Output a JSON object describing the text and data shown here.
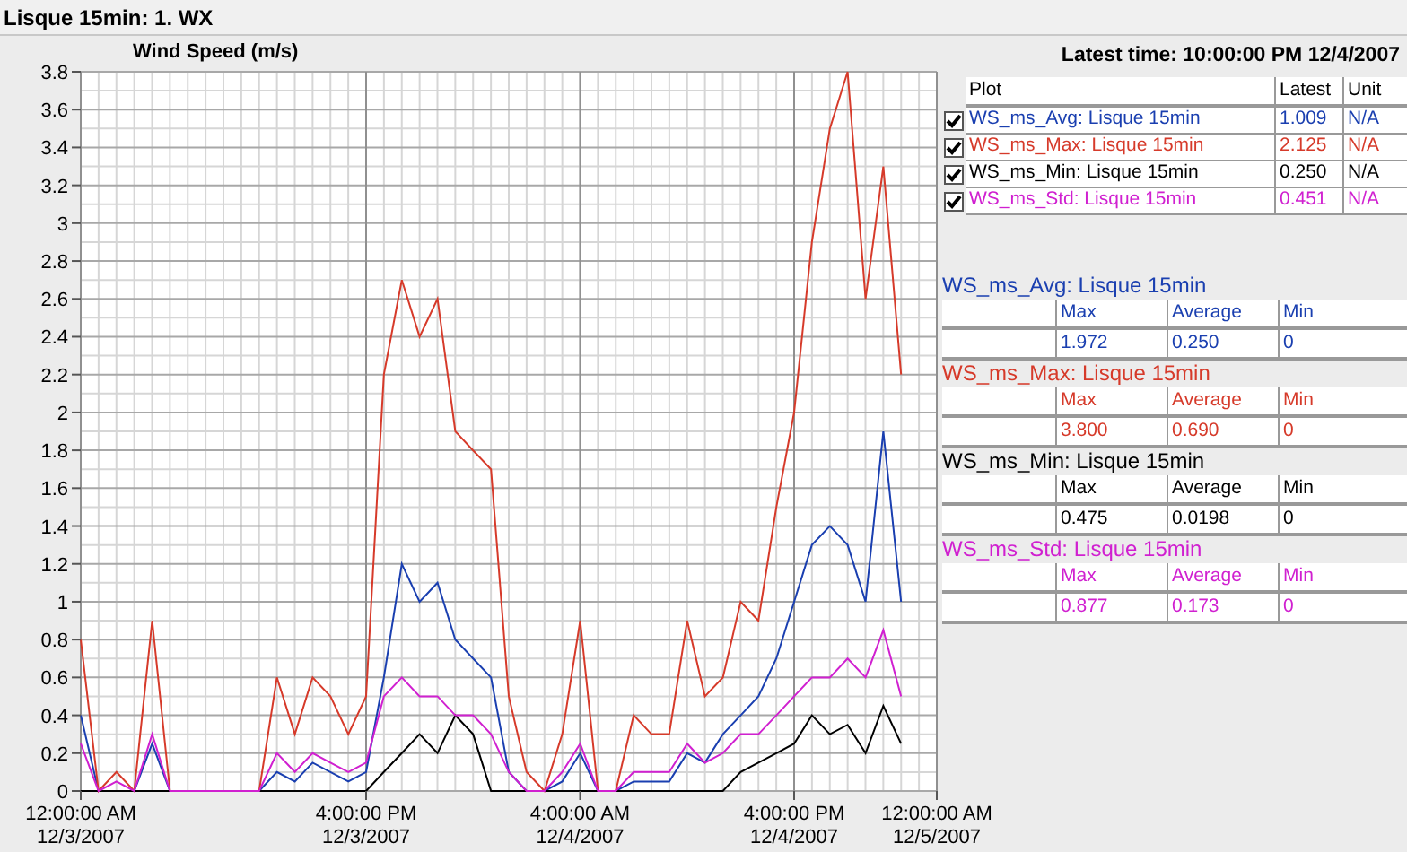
{
  "window": {
    "title": "Lisque 15min: 1. WX"
  },
  "chart": {
    "chart_data": {
      "type": "line",
      "grid": true,
      "title": "Wind Speed (m/s)",
      "categories": [
        "12:00:00 AM\n12/3/2007",
        null,
        null,
        null,
        null,
        null,
        null,
        null,
        null,
        null,
        null,
        null,
        null,
        null,
        null,
        null,
        "4:00:00 PM\n12/3/2007",
        null,
        null,
        null,
        null,
        null,
        null,
        null,
        null,
        null,
        null,
        null,
        "4:00:00 AM\n12/4/2007",
        null,
        null,
        null,
        null,
        null,
        null,
        null,
        null,
        null,
        null,
        null,
        "4:00:00 PM\n12/4/2007",
        null,
        null,
        null,
        null,
        null,
        null,
        null,
        "12:00:00 AM\n12/5/2007"
      ],
      "ylim": [
        0,
        3.8
      ],
      "yticks": [
        0,
        0.2,
        0.4,
        0.6,
        0.8,
        1,
        1.2,
        1.4,
        1.6,
        1.8,
        2,
        2.2,
        2.4,
        2.6,
        2.8,
        3,
        3.2,
        3.4,
        3.6,
        3.8
      ],
      "series": [
        {
          "color": "#1a3fb0",
          "values": [
            0.4,
            0,
            0,
            0,
            0.25,
            0,
            0,
            0,
            0,
            0,
            0,
            0.1,
            0.05,
            0.15,
            0.1,
            0.05,
            0.1,
            0.6,
            1.2,
            1.0,
            1.1,
            0.8,
            0.7,
            0.6,
            0.1,
            0,
            0,
            0.05,
            0.2,
            0,
            0,
            0.05,
            0.05,
            0.05,
            0.2,
            0.15,
            0.3,
            0.4,
            0.5,
            0.7,
            1.0,
            1.3,
            1.4,
            1.3,
            1.0,
            1.9,
            1.0,
            null,
            null
          ]
        },
        {
          "color": "#d63a2a",
          "values": [
            0.8,
            0,
            0.1,
            0,
            0.9,
            0,
            0,
            0,
            0,
            0,
            0,
            0.6,
            0.3,
            0.6,
            0.5,
            0.3,
            0.5,
            2.2,
            2.7,
            2.4,
            2.6,
            1.9,
            1.8,
            1.7,
            0.5,
            0.1,
            0,
            0.3,
            0.9,
            0,
            0,
            0.4,
            0.3,
            0.3,
            0.9,
            0.5,
            0.6,
            1.0,
            0.9,
            1.5,
            2.0,
            2.9,
            3.5,
            3.8,
            2.6,
            3.3,
            2.2,
            null,
            null
          ]
        },
        {
          "color": "#000000",
          "values": [
            0,
            0,
            0,
            0,
            0,
            0,
            0,
            0,
            0,
            0,
            0,
            0,
            0,
            0,
            0,
            0,
            0,
            0.1,
            0.2,
            0.3,
            0.2,
            0.4,
            0.3,
            0,
            0,
            0,
            0,
            0,
            0,
            0,
            0,
            0,
            0,
            0,
            0,
            0,
            0,
            0.1,
            0.15,
            0.2,
            0.25,
            0.4,
            0.3,
            0.35,
            0.2,
            0.45,
            0.25,
            null,
            null
          ]
        },
        {
          "color": "#d020d0",
          "values": [
            0.25,
            0,
            0.05,
            0,
            0.3,
            0,
            0,
            0,
            0,
            0,
            0,
            0.2,
            0.1,
            0.2,
            0.15,
            0.1,
            0.15,
            0.5,
            0.6,
            0.5,
            0.5,
            0.4,
            0.4,
            0.3,
            0.1,
            0,
            0,
            0.1,
            0.25,
            0,
            0,
            0.1,
            0.1,
            0.1,
            0.25,
            0.15,
            0.2,
            0.3,
            0.3,
            0.4,
            0.5,
            0.6,
            0.6,
            0.7,
            0.6,
            0.85,
            0.5,
            null,
            null
          ]
        }
      ]
    }
  },
  "latest_time": "Latest time: 10:00:00 PM 12/4/2007",
  "legend": {
    "columns": [
      "Plot",
      "Latest",
      "Unit"
    ],
    "rows": [
      {
        "plot": "WS_ms_Avg: Lisque 15min",
        "latest": "1.009",
        "unit": "N/A",
        "checked": true,
        "color": "#1a3fb0"
      },
      {
        "plot": "WS_ms_Max: Lisque 15min",
        "latest": "2.125",
        "unit": "N/A",
        "checked": true,
        "color": "#d63a2a"
      },
      {
        "plot": "WS_ms_Min: Lisque 15min",
        "latest": "0.250",
        "unit": "N/A",
        "checked": true,
        "color": "#000000"
      },
      {
        "plot": "WS_ms_Std: Lisque 15min",
        "latest": "0.451",
        "unit": "N/A",
        "checked": true,
        "color": "#d020d0"
      }
    ]
  },
  "stats": [
    {
      "title": "WS_ms_Avg: Lisque 15min",
      "color": "#1a3fb0",
      "columns": [
        "Max",
        "Average",
        "Min"
      ],
      "values": [
        "1.972",
        "0.250",
        "0"
      ]
    },
    {
      "title": "WS_ms_Max: Lisque 15min",
      "color": "#d63a2a",
      "columns": [
        "Max",
        "Average",
        "Min"
      ],
      "values": [
        "3.800",
        "0.690",
        "0"
      ]
    },
    {
      "title": "WS_ms_Min: Lisque 15min",
      "color": "#000000",
      "columns": [
        "Max",
        "Average",
        "Min"
      ],
      "values": [
        "0.475",
        "0.0198",
        "0"
      ]
    },
    {
      "title": "WS_ms_Std: Lisque 15min",
      "color": "#d020d0",
      "columns": [
        "Max",
        "Average",
        "Min"
      ],
      "values": [
        "0.877",
        "0.173",
        "0"
      ]
    }
  ]
}
